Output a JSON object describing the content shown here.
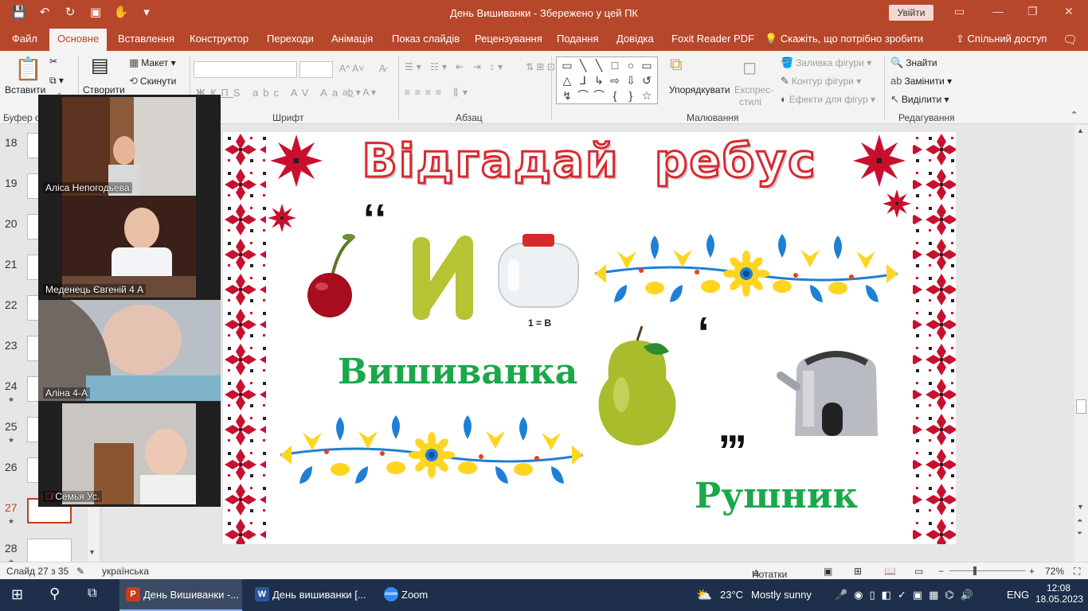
{
  "window": {
    "title": "День Вишиванки  -  Збережено у цей ПК",
    "sign_in": "Увійти"
  },
  "tabs": [
    "Файл",
    "Основне",
    "Вставлення",
    "Конструктор",
    "Переходи",
    "Анімація",
    "Показ слайдів",
    "Рецензування",
    "Подання",
    "Довідка",
    "Foxit Reader PDF",
    "Скажіть, що потрібно зробити"
  ],
  "active_tab": "Основне",
  "share_label": "Спільний доступ",
  "ribbon": {
    "paste": "Вставити",
    "create": "Створити",
    "layout": "Макет",
    "reset": "Скинути",
    "shape_fill": "Заливка фігури",
    "shape_outline": "Контур фігури",
    "shape_effects": "Ефекти для фігур",
    "arrange": "Упорядкувати",
    "quick_styles_1": "Експрес-",
    "quick_styles_2": "стилі",
    "find": "Знайти",
    "replace": "Замінити",
    "select": "Виділити",
    "groups": {
      "clipboard": "Буфер о",
      "font": "Шрифт",
      "paragraph": "Абзац",
      "drawing": "Малювання",
      "editing": "Редагування"
    }
  },
  "thumbnails": [
    {
      "num": "18",
      "star": false
    },
    {
      "num": "19",
      "star": false
    },
    {
      "num": "20",
      "star": false
    },
    {
      "num": "21",
      "star": false
    },
    {
      "num": "22",
      "star": false
    },
    {
      "num": "23",
      "star": false
    },
    {
      "num": "24",
      "star": true
    },
    {
      "num": "25",
      "star": true
    },
    {
      "num": "26",
      "star": false
    },
    {
      "num": "27",
      "star": true
    },
    {
      "num": "28",
      "star": true
    }
  ],
  "selected_slide": "27",
  "slide": {
    "title": "Відгадай  ребус",
    "jar_caption": "1 = В",
    "answer_1": "Вишиванка",
    "answer_2": "Рушник",
    "letter_i": "И",
    "quote_top": "‚‚",
    "comma_single": ",",
    "commas_triple": ",,,"
  },
  "zoom_participants": [
    {
      "name": "Аліса Непогодьева",
      "muted": false
    },
    {
      "name": "Меденець Євгеній 4 А",
      "muted": false
    },
    {
      "name": "Аліна 4-А",
      "muted": false
    },
    {
      "name": "Семья Ус.",
      "muted": true
    }
  ],
  "statusbar": {
    "slide_counter": "Слайд 27 з 35",
    "language": "українська",
    "notes": "Нотатки",
    "zoom": "72%"
  },
  "taskbar": {
    "apps": [
      {
        "label": "День Вишиванки -...",
        "icon": "P",
        "color": "#c43e1c"
      },
      {
        "label": "День вишиванки [...",
        "icon": "W",
        "color": "#2b579a"
      },
      {
        "label": "Zoom",
        "icon": "zoom",
        "color": "#2d8cff"
      }
    ],
    "weather_temp": "23°C",
    "weather_desc": "Mostly sunny",
    "lang": "ENG",
    "time": "12:08",
    "date": "18.05.2023"
  },
  "colors": {
    "accent": "#b7472a",
    "title_red": "#d9282f",
    "answer_green": "#1aa84a",
    "embroidery_red": "#c8102e",
    "ornament_yellow": "#ffd51f",
    "ornament_blue": "#1e7fd6"
  }
}
